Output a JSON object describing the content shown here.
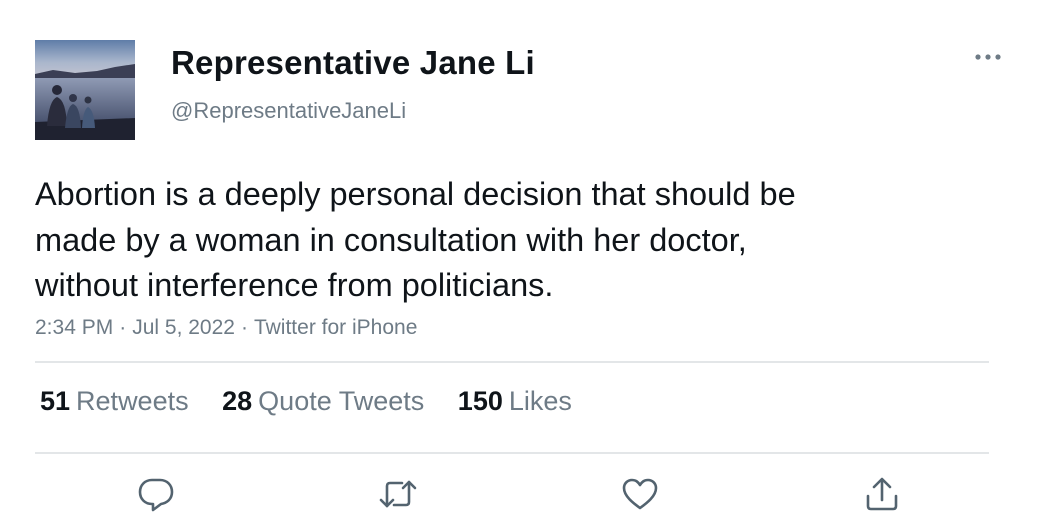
{
  "author": {
    "display_name": "Representative Jane Li",
    "handle": "@RepresentativeJaneLi",
    "avatar_icon": "avatar-photo-lakeside"
  },
  "tweet": {
    "text_lines": [
      "Abortion is a deeply personal decision that should be",
      "made by a woman in consultation with her doctor,",
      "without interference from politicians."
    ],
    "time": "2:34 PM",
    "date": "Jul 5, 2022",
    "source": "Twitter for iPhone",
    "separator": "·"
  },
  "stats": [
    {
      "count": "51",
      "label": "Retweets"
    },
    {
      "count": "28",
      "label": "Quote Tweets"
    },
    {
      "count": "150",
      "label": "Likes"
    }
  ],
  "actions": [
    {
      "name": "reply",
      "icon": "reply-icon"
    },
    {
      "name": "retweet",
      "icon": "retweet-icon"
    },
    {
      "name": "like",
      "icon": "like-icon"
    },
    {
      "name": "share",
      "icon": "share-icon"
    }
  ],
  "colors": {
    "text_primary": "#0f1419",
    "text_secondary": "#6e7b86",
    "divider": "#e3e6e8",
    "icon": "#53636f"
  }
}
